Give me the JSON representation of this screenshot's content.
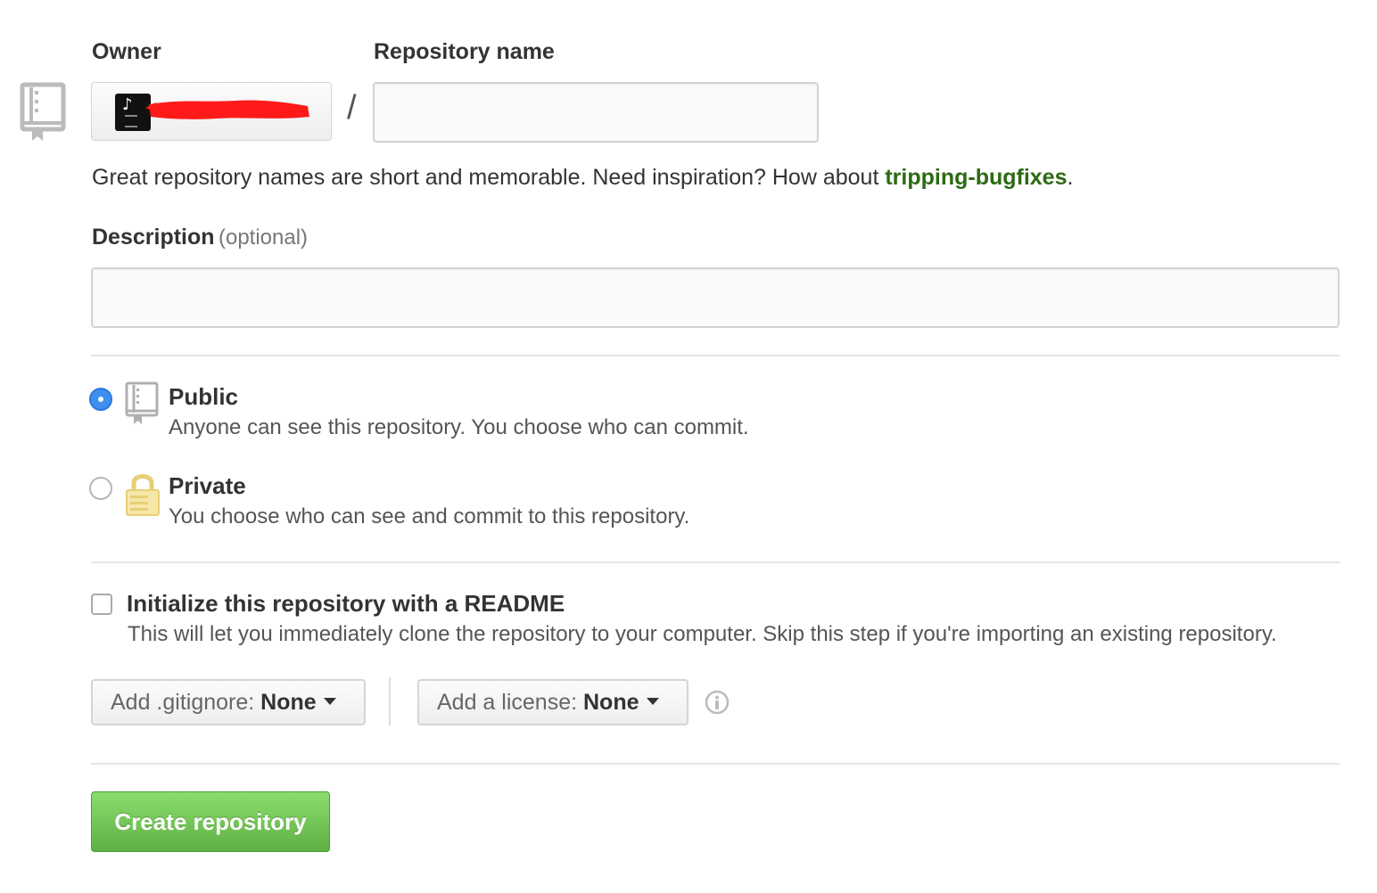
{
  "owner": {
    "label": "Owner",
    "avatar_icon": "music-note-avatar"
  },
  "repository": {
    "label": "Repository name",
    "value": "",
    "separator": "/"
  },
  "hint": {
    "text": "Great repository names are short and memorable. Need inspiration? How about ",
    "suggestion": "tripping-bugfixes",
    "end": "."
  },
  "description": {
    "label": "Description",
    "optional": "(optional)",
    "value": ""
  },
  "visibility": {
    "selected": "public",
    "public": {
      "title": "Public",
      "desc": "Anyone can see this repository. You choose who can commit."
    },
    "private": {
      "title": "Private",
      "desc": "You choose who can see and commit to this repository."
    }
  },
  "readme": {
    "checked": false,
    "title": "Initialize this repository with a README",
    "desc": "This will let you immediately clone the repository to your computer. Skip this step if you're importing an existing repository."
  },
  "gitignore": {
    "prefix": "Add .gitignore: ",
    "value": "None"
  },
  "license": {
    "prefix": "Add a license: ",
    "value": "None"
  },
  "submit": {
    "label": "Create repository"
  },
  "colors": {
    "accent_green": "#60b044",
    "suggestion_green": "#2c6a13",
    "radio_blue": "#3f8ff0",
    "redaction_red": "#ff1a1a"
  }
}
